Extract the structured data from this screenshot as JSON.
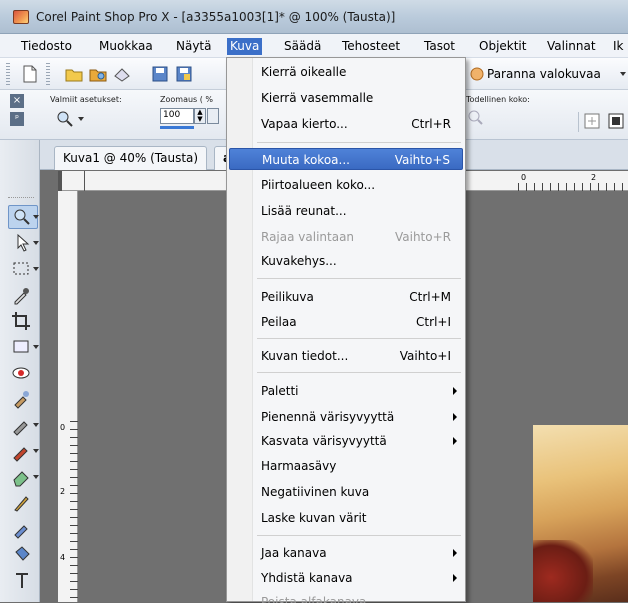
{
  "window": {
    "title": "Corel Paint Shop Pro X - [a3355a1003[1]* @ 100% (Tausta)]"
  },
  "menubar": {
    "items": [
      {
        "label": "Tiedosto"
      },
      {
        "label": "Muokkaa"
      },
      {
        "label": "Näytä"
      },
      {
        "label": "Kuva"
      },
      {
        "label": "Säädä"
      },
      {
        "label": "Tehosteet"
      },
      {
        "label": "Tasot"
      },
      {
        "label": "Objektit"
      },
      {
        "label": "Valinnat"
      },
      {
        "label": "Ik"
      }
    ]
  },
  "toolbar": {
    "enhance_label": "Paranna valokuvaa"
  },
  "optionsbar": {
    "presets_label": "Valmiit asetukset:",
    "zoom_label": "Zoomaus ( %",
    "zoom_value": "100",
    "actual_size_label": "Todellinen koko:"
  },
  "tabs": [
    {
      "label": "Kuva1 @ 40% (Tausta)"
    },
    {
      "label": "a"
    }
  ],
  "image_menu": {
    "items": [
      {
        "label": "Kierrä oikealle",
        "shortcut": ""
      },
      {
        "label": "Kierrä vasemmalle",
        "shortcut": ""
      },
      {
        "label": "Vapaa kierto...",
        "shortcut": "Ctrl+R"
      },
      {
        "label": "Muuta kokoa...",
        "shortcut": "Vaihto+S"
      },
      {
        "label": "Piirtoalueen koko...",
        "shortcut": ""
      },
      {
        "label": "Lisää reunat...",
        "shortcut": ""
      },
      {
        "label": "Rajaa valintaan",
        "shortcut": "Vaihto+R"
      },
      {
        "label": "Kuvakehys...",
        "shortcut": ""
      },
      {
        "label": "Peilikuva",
        "shortcut": "Ctrl+M"
      },
      {
        "label": "Peilaa",
        "shortcut": "Ctrl+I"
      },
      {
        "label": "Kuvan tiedot...",
        "shortcut": "Vaihto+I"
      },
      {
        "label": "Paletti",
        "shortcut": ""
      },
      {
        "label": "Pienennä värisyvyyttä",
        "shortcut": ""
      },
      {
        "label": "Kasvata värisyvyyttä",
        "shortcut": ""
      },
      {
        "label": "Harmaasävy",
        "shortcut": ""
      },
      {
        "label": "Negatiivinen kuva",
        "shortcut": ""
      },
      {
        "label": "Laske kuvan värit",
        "shortcut": ""
      },
      {
        "label": "Jaa kanava",
        "shortcut": ""
      },
      {
        "label": "Yhdistä kanava",
        "shortcut": ""
      },
      {
        "label": "Poista alfakanava",
        "shortcut": ""
      }
    ],
    "highlighted": "Muuta kokoa...",
    "disabled": [
      "Rajaa valintaan"
    ]
  },
  "ruler": {
    "h_labels": [
      "0",
      "2"
    ],
    "v_labels": [
      "0",
      "2",
      "4"
    ]
  },
  "colors": {
    "highlight": "#3a6ac2",
    "menubar_active": "#3b6fc8"
  }
}
